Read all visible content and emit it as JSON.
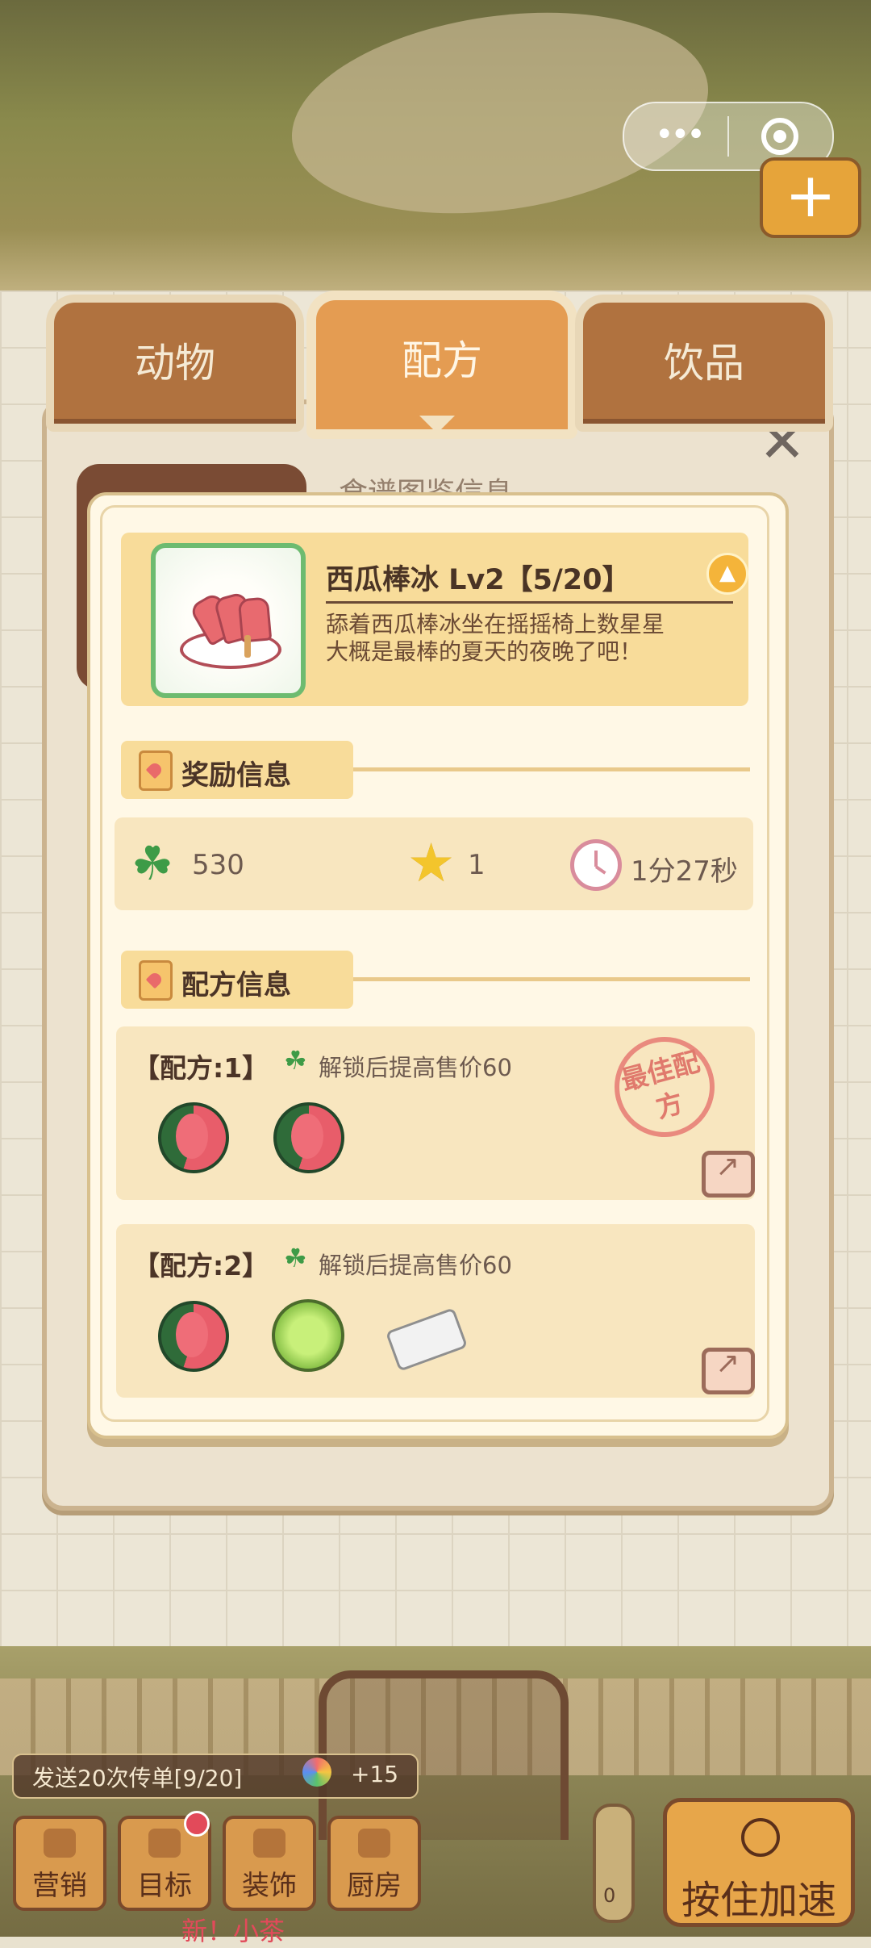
{
  "top_bar": {
    "capsule_menu_icon": "more-dots-icon",
    "capsule_close_icon": "target-circle-icon",
    "plus_label": "+"
  },
  "tabs": [
    {
      "label": "动物",
      "active": false
    },
    {
      "label": "配方",
      "active": true
    },
    {
      "label": "饮品",
      "active": false
    }
  ],
  "panel": {
    "title": "食谱图鉴信息",
    "close_label": "✕"
  },
  "item": {
    "name": "西瓜棒冰 Lv2【5/20】",
    "description_line1": "舔着西瓜棒冰坐在摇摇椅上数星星",
    "description_line2": "大概是最棒的夏天的夜晚了吧！"
  },
  "rewards": {
    "title": "奖励信息",
    "clover": "530",
    "stars": "1",
    "time": "1分27秒"
  },
  "recipe_section": {
    "title": "配方信息"
  },
  "recipes": [
    {
      "label": "【配方:1】",
      "note": "解锁后提高售价60",
      "ingredients": [
        "watermelon",
        "watermelon"
      ],
      "stamp": "最佳配方"
    },
    {
      "label": "【配方:2】",
      "note": "解锁后提高售价60",
      "ingredients": [
        "watermelon",
        "lime",
        "ice"
      ]
    }
  ],
  "bottom": {
    "task_text": "发送20次传单[9/20]",
    "task_reward": "+15",
    "buttons": [
      "营销",
      "目标",
      "装饰",
      "厨房"
    ],
    "speed_label": "按住加速",
    "thermo_value": "0",
    "new_label": "新！小茶"
  },
  "colors": {
    "accent": "#e49c52",
    "tab_inactive": "#b0723f",
    "card": "#f8dc9a",
    "clover": "#3e9b47"
  }
}
